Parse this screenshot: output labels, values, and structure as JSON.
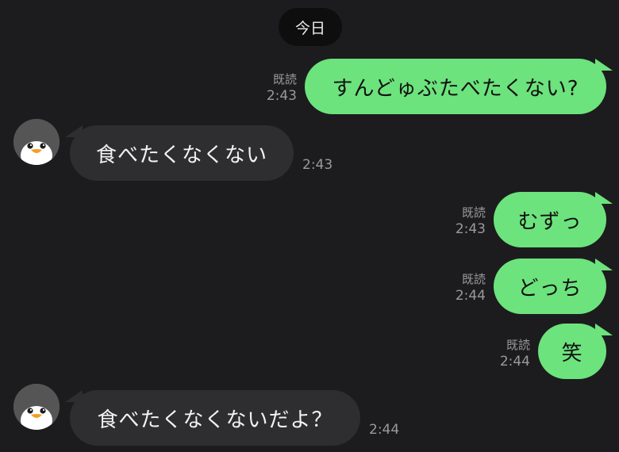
{
  "date_separator": "今日",
  "colors": {
    "background": "#1c1c1e",
    "outgoing_bubble": "#6ce37d",
    "incoming_bubble": "#2e2e30",
    "meta_text": "#9a9a9c"
  },
  "messages": [
    {
      "direction": "out",
      "text": "すんどゅぶたべたくない?",
      "read": "既読",
      "time": "2:43"
    },
    {
      "direction": "in",
      "text": "食べたくなくない",
      "time": "2:43",
      "avatar": "penguin-icon"
    },
    {
      "direction": "out",
      "text": "むずっ",
      "read": "既読",
      "time": "2:43"
    },
    {
      "direction": "out",
      "text": "どっち",
      "read": "既読",
      "time": "2:44"
    },
    {
      "direction": "out",
      "text": "笑",
      "read": "既読",
      "time": "2:44"
    },
    {
      "direction": "in",
      "text": "食べたくなくないだよ？",
      "time": "2:44",
      "avatar": "penguin-icon"
    }
  ]
}
